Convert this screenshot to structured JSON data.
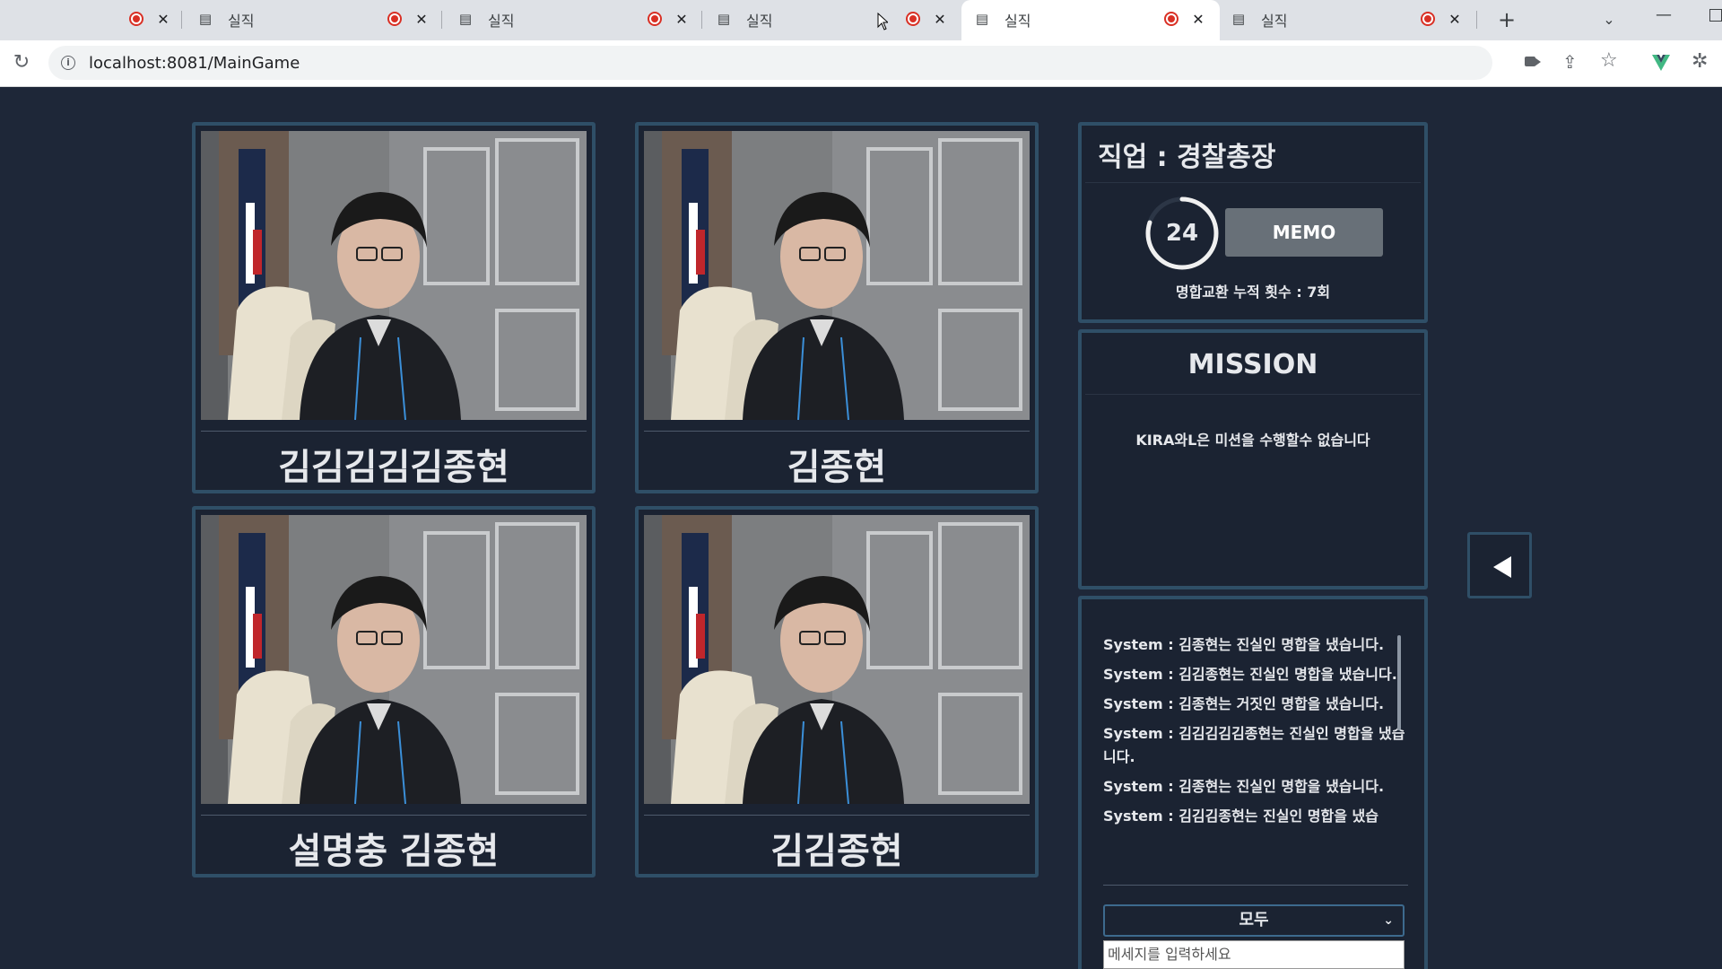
{
  "browser": {
    "tabs": [
      {
        "title": "실직",
        "active": false
      },
      {
        "title": "실직",
        "active": false
      },
      {
        "title": "실직",
        "active": false
      },
      {
        "title": "실직",
        "active": true
      },
      {
        "title": "실직",
        "active": false
      }
    ],
    "url": "localhost:8081/MainGame"
  },
  "players": [
    {
      "name": "김김김김김종현"
    },
    {
      "name": "김종현"
    },
    {
      "name": "설명충 김종현"
    },
    {
      "name": "김김종현"
    }
  ],
  "job": {
    "title": "직업 : 경찰총장",
    "timer": "24",
    "timer_fraction": 0.8,
    "memo_label": "MEMO",
    "exchange_count": "명합교환 누적 횟수 : 7회"
  },
  "mission": {
    "title": "MISSION",
    "text": "KIRA와L은 미션을 수행할수 없습니다"
  },
  "chat": {
    "messages": [
      "System : 김종현는 진실인 명합을 냈습니다.",
      "System : 김김종현는 진실인 명합을 냈습니다.",
      "System : 김종현는 거짓인 명합을 냈습니다.",
      "System : 김김김김김종현는 진실인 명합을 냈습니다.",
      "System : 김종현는 진실인 명합을 냈습니다.",
      "System : 김김김종현는 진실인 명합을 냈습"
    ],
    "channel": "모두",
    "placeholder": "메세지를 입력하세요"
  },
  "colors": {
    "background": "#1e2738",
    "panel_border": "#2f4f67",
    "recording_red": "#d93025",
    "memo_button": "#687078"
  }
}
